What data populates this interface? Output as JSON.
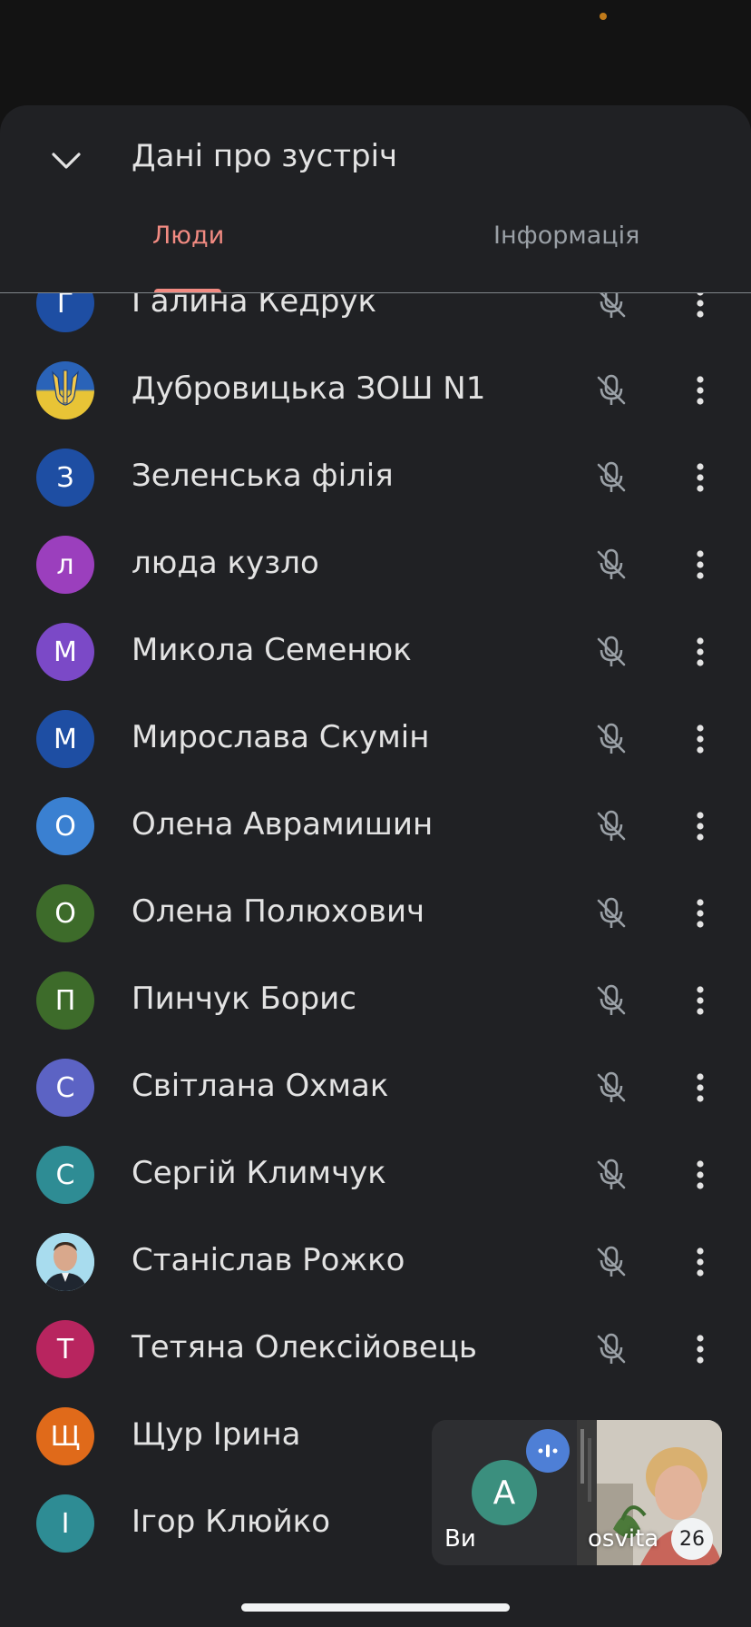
{
  "header": {
    "title": "Дані про зустріч"
  },
  "tabs": {
    "people": "Люди",
    "info": "Інформація",
    "selected": "people"
  },
  "colors": {
    "accent": "#f28b82",
    "sheet_bg": "#202124",
    "text": "#e3e3e3",
    "muted": "#9aa0a6"
  },
  "participants": [
    {
      "initial": "Г",
      "name": "Галина Кедрук",
      "avatar_color": "#1e4ea3",
      "mic": "muted"
    },
    {
      "initial": "",
      "name": "Дубровицька ЗОШ N1",
      "avatar_color": "#1a56a8",
      "avatar_image": "ukraine-trident-emblem",
      "mic": "muted"
    },
    {
      "initial": "З",
      "name": "Зеленська філія",
      "avatar_color": "#1e4ea3",
      "mic": "muted"
    },
    {
      "initial": "л",
      "name": "люда кузло",
      "avatar_color": "#9b3fbd",
      "mic": "muted"
    },
    {
      "initial": "М",
      "name": "Микола Семенюк",
      "avatar_color": "#7b49c7",
      "mic": "muted"
    },
    {
      "initial": "М",
      "name": "Мирослава Скумін",
      "avatar_color": "#1e4ea3",
      "mic": "muted"
    },
    {
      "initial": "О",
      "name": "Олена Аврамишин",
      "avatar_color": "#3a80d1",
      "mic": "muted"
    },
    {
      "initial": "О",
      "name": "Олена Полюхович",
      "avatar_color": "#3d6b2a",
      "mic": "muted"
    },
    {
      "initial": "П",
      "name": "Пинчук Борис",
      "avatar_color": "#3d6b2a",
      "mic": "muted"
    },
    {
      "initial": "С",
      "name": "Світлана Охмак",
      "avatar_color": "#5c63c4",
      "mic": "muted"
    },
    {
      "initial": "С",
      "name": "Сергій Климчук",
      "avatar_color": "#2e8c94",
      "mic": "muted"
    },
    {
      "initial": "",
      "name": "Станіслав Рожко",
      "avatar_color": "#9fd4e8",
      "avatar_image": "man-portrait-photo",
      "mic": "muted"
    },
    {
      "initial": "Т",
      "name": "Тетяна Олексійовець",
      "avatar_color": "#b8255f",
      "mic": "muted"
    },
    {
      "initial": "Щ",
      "name": "Щур Ірина",
      "avatar_color": "#e06a1a",
      "mic": "muted"
    },
    {
      "initial": "І",
      "name": "Ігор Клюйко",
      "avatar_color": "#2e8c94",
      "mic": "muted"
    }
  ],
  "pip": {
    "self_initial": "A",
    "self_label": "Ви",
    "self_avatar_color": "#3b8f7e",
    "other_label": "osvita",
    "count": "26"
  }
}
